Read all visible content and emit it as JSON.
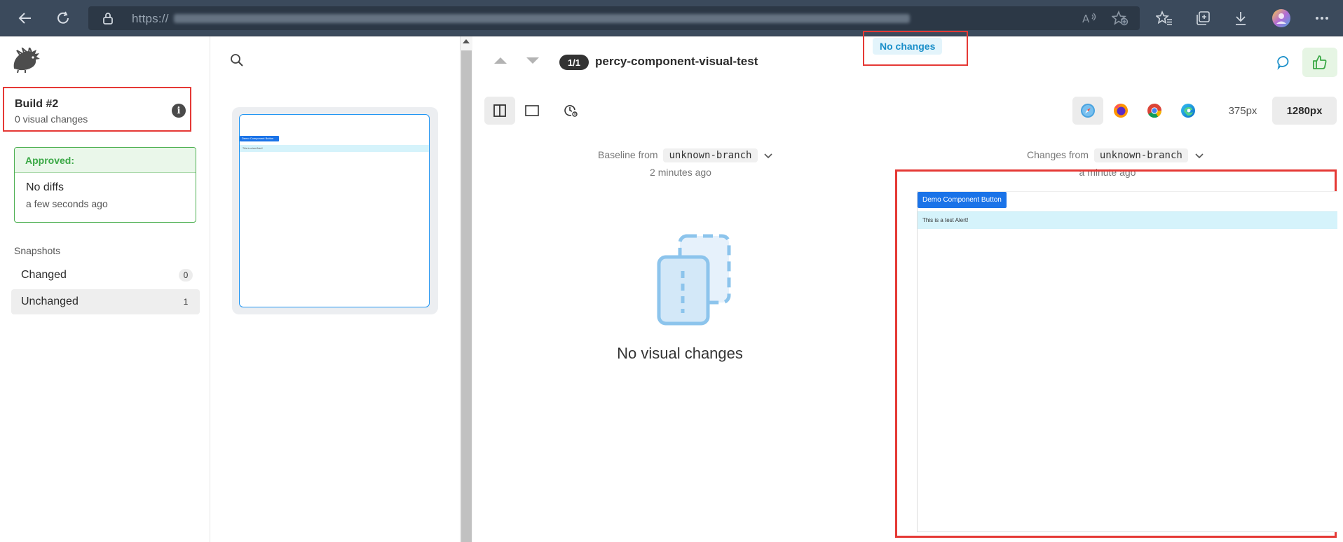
{
  "browser": {
    "url_visible": "https://"
  },
  "sidebar": {
    "build_title": "Build #2",
    "build_sub": "0 visual changes",
    "info_glyph": "i",
    "approved_label": "Approved:",
    "approved_title": "No diffs",
    "approved_time": "a few seconds ago",
    "snapshots_label": "Snapshots",
    "items": [
      {
        "label": "Changed",
        "count": "0"
      },
      {
        "label": "Unchanged",
        "count": "1"
      }
    ]
  },
  "thumbnail": {
    "button_text": "Demo Component Button",
    "alert_text": "This is a test Alert!"
  },
  "header": {
    "counter": "1/1",
    "snapshot_name": "percy-component-visual-test",
    "status_badge": "No changes"
  },
  "toolbar": {
    "widths": [
      "375px",
      "1280px"
    ]
  },
  "baseline": {
    "prefix": "Baseline from",
    "branch": "unknown-branch",
    "time": "2 minutes ago"
  },
  "changes": {
    "prefix": "Changes from",
    "branch": "unknown-branch",
    "time": "a minute ago"
  },
  "empty_state": {
    "message": "No visual changes"
  },
  "preview": {
    "button_text": "Demo Component Button",
    "alert_text": "This is a test Alert!"
  },
  "colors": {
    "browser_bar": "#3b4a5c",
    "highlight_red": "#e53935",
    "approved_green": "#3aa845",
    "status_blue": "#1a8fc9",
    "primary_blue": "#1a73e8"
  },
  "icons": [
    "back-icon",
    "refresh-icon",
    "lock-icon",
    "read-aloud-icon",
    "favorite-add-icon",
    "favorites-icon",
    "collections-icon",
    "download-icon",
    "profile-avatar",
    "more-icon",
    "percy-logo",
    "info-icon",
    "search-icon",
    "split-view-icon",
    "single-view-icon",
    "history-icon",
    "safari-icon",
    "firefox-icon",
    "chrome-icon",
    "edge-icon",
    "comment-icon",
    "thumbs-up-icon",
    "chevron-down-icon",
    "empty-state-illustration"
  ]
}
